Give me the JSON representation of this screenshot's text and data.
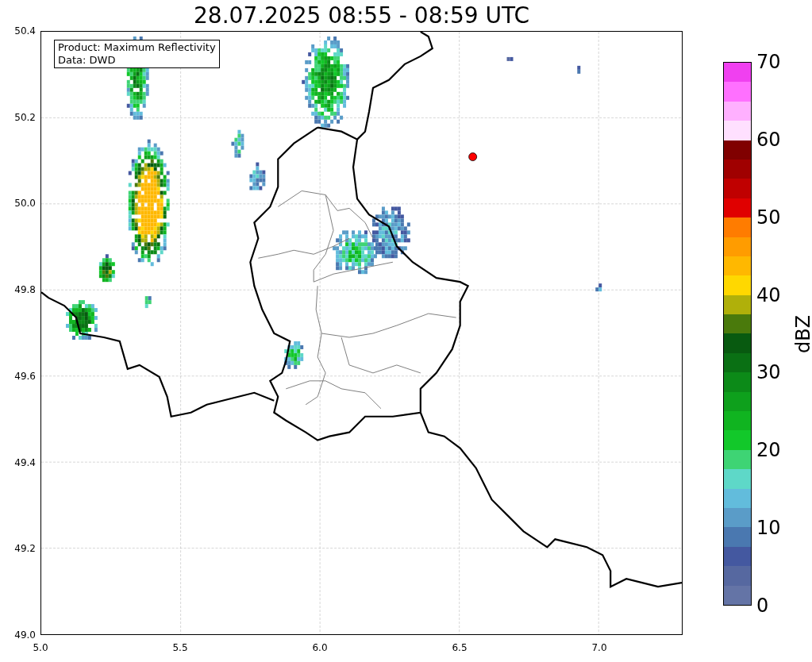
{
  "title": "28.07.2025 08:55 - 08:59 UTC",
  "legend": [
    "Product: Maximum Reflectivity",
    "Data: DWD"
  ],
  "y_axis": {
    "ticks": [
      "50.4",
      "50.2",
      "50.0",
      "49.8",
      "49.6",
      "49.4",
      "49.2",
      "49.0"
    ]
  },
  "x_axis": {
    "ticks": [
      "5.0",
      "5.5",
      "6.0",
      "6.5",
      "7.0"
    ]
  },
  "colorbar": {
    "label": "dBZ",
    "ticks": [
      "70",
      "60",
      "50",
      "40",
      "30",
      "20",
      "10",
      "0"
    ],
    "bins": [
      {
        "color": "#f040f0"
      },
      {
        "color": "#ff70ff"
      },
      {
        "color": "#ffb0ff"
      },
      {
        "color": "#ffe0ff"
      },
      {
        "color": "#800000"
      },
      {
        "color": "#a00000"
      },
      {
        "color": "#c00000"
      },
      {
        "color": "#e00000"
      },
      {
        "color": "#ff7c00"
      },
      {
        "color": "#ff9c00"
      },
      {
        "color": "#ffb800"
      },
      {
        "color": "#ffd800"
      },
      {
        "color": "#b0b00a"
      },
      {
        "color": "#4a7a0c"
      },
      {
        "color": "#085a10"
      },
      {
        "color": "#0a7014"
      },
      {
        "color": "#0c8a18"
      },
      {
        "color": "#0ea01c"
      },
      {
        "color": "#10b420"
      },
      {
        "color": "#12c82a"
      },
      {
        "color": "#3ed474"
      },
      {
        "color": "#5ed8c8"
      },
      {
        "color": "#62bcdc"
      },
      {
        "color": "#5a9cc8"
      },
      {
        "color": "#4a78b0"
      },
      {
        "color": "#4458a0"
      },
      {
        "color": "#5668a0"
      },
      {
        "color": "#6474a6"
      }
    ]
  }
}
